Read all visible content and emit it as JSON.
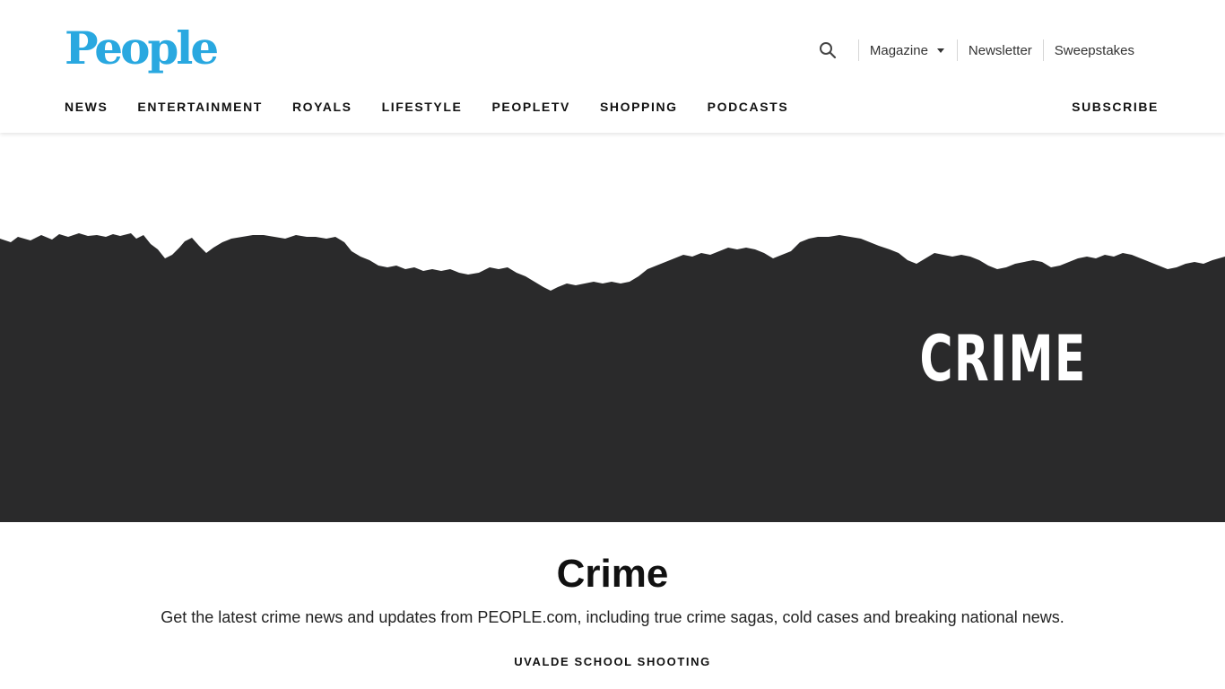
{
  "header": {
    "logo_text": "People",
    "search_icon": "search-icon",
    "utility": {
      "magazine": "Magazine",
      "newsletter": "Newsletter",
      "sweepstakes": "Sweepstakes"
    },
    "nav": [
      "NEWS",
      "ENTERTAINMENT",
      "ROYALS",
      "LIFESTYLE",
      "PEOPLETV",
      "SHOPPING",
      "PODCASTS"
    ],
    "subscribe": "SUBSCRIBE"
  },
  "hero": {
    "title": "CRIME",
    "background_color": "#2a2a2b"
  },
  "main": {
    "title": "Crime",
    "description": "Get the latest crime news and updates from PEOPLE.com, including true crime sagas, cold cases and breaking national news.",
    "tag": "UVALDE SCHOOL SHOOTING"
  },
  "colors": {
    "brand": "#29a8e0",
    "text": "#111111"
  }
}
